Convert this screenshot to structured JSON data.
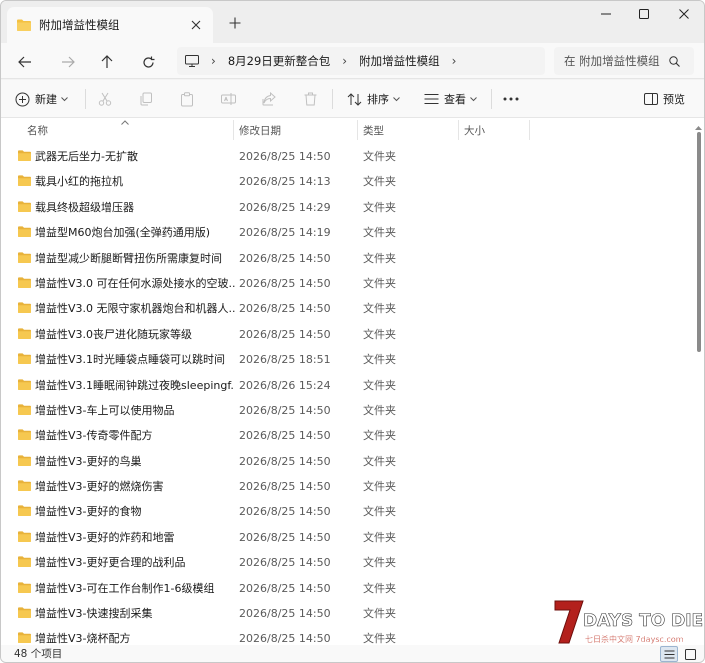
{
  "window": {
    "tab_title": "附加增益性模组",
    "controls": {
      "minimize": "minimize-icon",
      "maximize": "maximize-icon",
      "close": "close-icon"
    }
  },
  "address": {
    "breadcrumbs": [
      "8月29日更新整合包",
      "附加增益性模组"
    ],
    "search_placeholder": "在 附加增益性模组 中搜索"
  },
  "commands": {
    "new_label": "新建",
    "sort_label": "排序",
    "view_label": "查看",
    "preview_label": "预览"
  },
  "columns": {
    "name": "名称",
    "date": "修改日期",
    "type": "类型",
    "size": "大小"
  },
  "files": [
    {
      "name": "武器无后坐力-无扩散",
      "date": "2026/8/25 14:50",
      "type": "文件夹"
    },
    {
      "name": "载具小红的拖拉机",
      "date": "2026/8/25 14:13",
      "type": "文件夹"
    },
    {
      "name": "载具终极超级增压器",
      "date": "2026/8/25 14:29",
      "type": "文件夹"
    },
    {
      "name": "增益型M60炮台加强(全弹药通用版)",
      "date": "2026/8/25 14:19",
      "type": "文件夹"
    },
    {
      "name": "增益型减少断腿断臂扭伤所需康复时间",
      "date": "2026/8/25 14:50",
      "type": "文件夹"
    },
    {
      "name": "增益性V3.0 可在任何水源处接水的空玻...",
      "date": "2026/8/25 14:50",
      "type": "文件夹"
    },
    {
      "name": "增益性V3.0 无限守家机器炮台和机器人...",
      "date": "2026/8/25 14:50",
      "type": "文件夹"
    },
    {
      "name": "增益性V3.0丧尸进化随玩家等级",
      "date": "2026/8/25 14:50",
      "type": "文件夹"
    },
    {
      "name": "增益性V3.1时光睡袋点睡袋可以跳时间",
      "date": "2026/8/25 18:51",
      "type": "文件夹"
    },
    {
      "name": "增益性V3.1睡眠闹钟跳过夜晚sleepingf...",
      "date": "2026/8/26 15:24",
      "type": "文件夹"
    },
    {
      "name": "增益性V3-车上可以使用物品",
      "date": "2026/8/25 14:50",
      "type": "文件夹"
    },
    {
      "name": "增益性V3-传奇零件配方",
      "date": "2026/8/25 14:50",
      "type": "文件夹"
    },
    {
      "name": "增益性V3-更好的鸟巢",
      "date": "2026/8/25 14:50",
      "type": "文件夹"
    },
    {
      "name": "增益性V3-更好的燃烧伤害",
      "date": "2026/8/25 14:50",
      "type": "文件夹"
    },
    {
      "name": "增益性V3-更好的食物",
      "date": "2026/8/25 14:50",
      "type": "文件夹"
    },
    {
      "name": "增益性V3-更好的炸药和地雷",
      "date": "2026/8/25 14:50",
      "type": "文件夹"
    },
    {
      "name": "增益性V3-更好更合理的战利品",
      "date": "2026/8/25 14:50",
      "type": "文件夹"
    },
    {
      "name": "增益性V3-可在工作台制作1-6级模组",
      "date": "2026/8/25 14:50",
      "type": "文件夹"
    },
    {
      "name": "增益性V3-快速搜刮采集",
      "date": "2026/8/25 14:50",
      "type": "文件夹"
    },
    {
      "name": "增益性V3-烧杯配方",
      "date": "2026/8/25 14:50",
      "type": "文件夹"
    }
  ],
  "status": {
    "item_count": "48 个项目"
  },
  "watermark": {
    "logo_text": "7DAYS TO DIE",
    "site_text": "七日杀中文网 7daysc.com"
  },
  "colors": {
    "folder": "#f4c142",
    "folder_dark": "#e0a82a",
    "scroll_thumb": "#8a8a8a",
    "accent": "#0067c0"
  }
}
